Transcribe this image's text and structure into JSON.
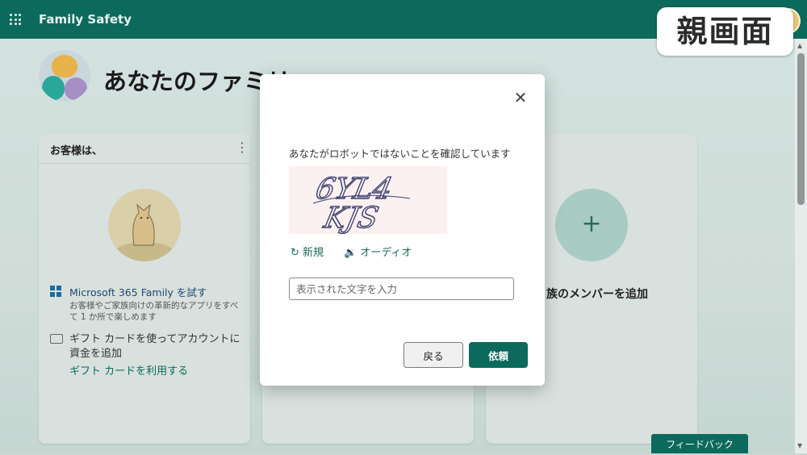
{
  "topbar": {
    "app_title": "Family Safety"
  },
  "overlay_label": "親画面",
  "page": {
    "title": "あなたのファミリ"
  },
  "cards": {
    "left": {
      "header": "お客様は、",
      "ms_title": "Microsoft 365 Family を試す",
      "ms_desc": "お客様やご家族向けの革新的なアプリをすべて 1 か所で楽しめます",
      "gift_text": "ギフト カードを使ってアカウントに資金を追加",
      "gift_link": "ギフト カードを利用する"
    },
    "right": {
      "add_label": "族のメンバーを追加"
    }
  },
  "dialog": {
    "message": "あなたがロボットではないことを確認しています",
    "captcha_text": "6YL4 KJS",
    "refresh_label": "新規",
    "audio_label": "オーディオ",
    "input_placeholder": "表示された文字を入力",
    "input_value": "",
    "back_label": "戻る",
    "request_label": "依頼"
  },
  "feedback_label": "フィードバック",
  "colors": {
    "brand": "#0b6a5b",
    "overlay": "#c9d8d4"
  },
  "icons": [
    "waffle-icon",
    "close-icon",
    "refresh-icon",
    "speaker-icon",
    "plus-icon",
    "microsoft-logo-icon",
    "gift-card-icon",
    "kebab-icon"
  ]
}
